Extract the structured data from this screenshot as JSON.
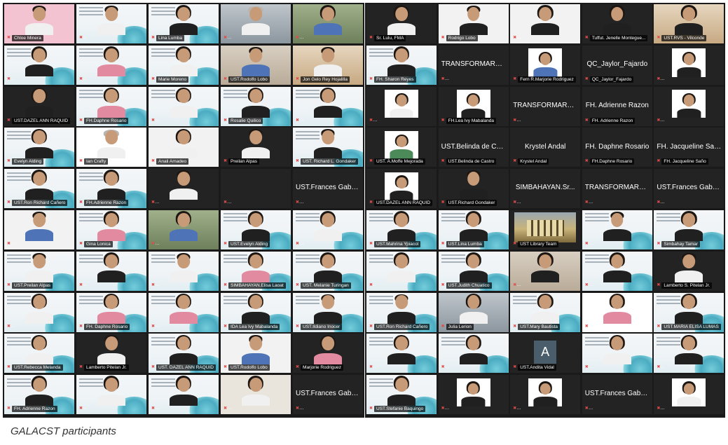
{
  "caption": "GALACST participants",
  "left_panel": [
    {
      "name": "Chloe Minera",
      "bg": "pink",
      "kind": "person",
      "hair": "short",
      "shirt": "white"
    },
    {
      "name": "UST.ALANNOYHUGO C.REYES",
      "bg": "slide",
      "kind": "person",
      "hair": "short",
      "shirt": "white"
    },
    {
      "name": "Lina Lumba",
      "bg": "slide",
      "kind": "person",
      "shirt": "black"
    },
    {
      "name": "SMH. Sr. Rosy Rampaje, O.P.",
      "bg": "room2",
      "kind": "person",
      "hair": "gray",
      "shirt": "white"
    },
    {
      "name": "Simbahayan. Sr. Maurice Bu...",
      "bg": "green",
      "kind": "person",
      "shirt": "blue"
    },
    {
      "name": "UST.KATRINA MARIA MITSRANAN",
      "bg": "slide",
      "kind": "person",
      "shirt": "black"
    },
    {
      "name": "IDA. Marie Vinna Gamusan",
      "bg": "slide",
      "kind": "person",
      "shirt": "pink"
    },
    {
      "name": "Marie Moreno",
      "bg": "slide",
      "kind": "person",
      "shirt": "white"
    },
    {
      "name": "UST.Rodolfo Lobo",
      "bg": "room",
      "kind": "person",
      "hair": "short",
      "shirt": "blue"
    },
    {
      "name": "Jon Gelo Rey Hojalilla",
      "bg": "warm",
      "kind": "person",
      "hair": "short",
      "shirt": "white"
    },
    {
      "name": "UST.DAZEL ANN RAQUID",
      "bg": "dark",
      "kind": "person",
      "shirt": "black"
    },
    {
      "name": "FH.Daphne Rosario",
      "bg": "slide",
      "kind": "person",
      "shirt": "pink"
    },
    {
      "name": "UST.CAMILLA J. VECCHIOS",
      "bg": "slide",
      "kind": "person",
      "shirt": "white"
    },
    {
      "name": "Rosalie Quilico",
      "bg": "slide",
      "kind": "person",
      "shirt": "black"
    },
    {
      "name": "UST.ROSALYN D.MIRANDO",
      "bg": "slide",
      "kind": "person",
      "shirt": "black"
    },
    {
      "name": "Evelyn Alding",
      "bg": "slide",
      "kind": "person",
      "shirt": "black"
    },
    {
      "name": "Ian Crafty",
      "bg": "white",
      "kind": "person",
      "hair": "gray",
      "shirt": "white"
    },
    {
      "name": "Anali Amadeo",
      "bg": "plain",
      "kind": "person",
      "shirt": "white"
    },
    {
      "name": "Preilan Alpas",
      "bg": "dark",
      "kind": "person",
      "hair": "short",
      "shirt": "white"
    },
    {
      "name": "UST. Richard L. Gondaker",
      "bg": "slide",
      "kind": "person",
      "hair": "short",
      "shirt": "black"
    },
    {
      "name": "UST.Ron Richard Cañero",
      "bg": "slide",
      "kind": "person",
      "shirt": "black"
    },
    {
      "name": "FH.Adrienne Razon",
      "bg": "slide",
      "kind": "person",
      "shirt": "black"
    },
    {
      "name": "CAMPHS-Lamberto Pitelan Jr.",
      "bg": "dark",
      "kind": "person",
      "hair": "short",
      "shirt": "white"
    },
    {
      "name": "TRANSFORMARE.JESSICA FE...",
      "bg": "dark",
      "kind": "empty"
    },
    {
      "name": "UST.Frances Gabrielle Cruz 1",
      "bg": "dark",
      "kind": "text",
      "label": "UST.Frances Gabri...",
      "active": true
    },
    {
      "name": "SIMBAHAYAN.Madeleine Te...",
      "bg": "plain",
      "kind": "person",
      "hair": "short",
      "shirt": "blue"
    },
    {
      "name": "Gina Lonica",
      "bg": "slide",
      "kind": "person",
      "shirt": "pink"
    },
    {
      "name": "Simbahayan. Sr. Maurice Bu...",
      "bg": "green",
      "kind": "person",
      "shirt": "blue"
    },
    {
      "name": "UST.Evelyn Alding",
      "bg": "slide",
      "kind": "person",
      "shirt": "black"
    },
    {
      "name": "SIMBAHAYAN.Sr.Shirley G. All...",
      "bg": "slide",
      "kind": "person",
      "shirt": "white"
    },
    {
      "name": "UST.Preilan Alpas",
      "bg": "slide",
      "kind": "person",
      "hair": "short",
      "shirt": "white"
    },
    {
      "name": "UST.KATRINA MARIA M.TERA...",
      "bg": "slide",
      "kind": "person",
      "shirt": "black"
    },
    {
      "name": "UST.ALANNOYHUGO C.REYES",
      "bg": "slide",
      "kind": "person",
      "hair": "short",
      "shirt": "white"
    },
    {
      "name": "SIMBAHAYAN.Elisa Laoat",
      "bg": "slide",
      "kind": "person",
      "shirt": "pink"
    },
    {
      "name": "UST. Melanie Turingan",
      "bg": "slide",
      "kind": "person",
      "shirt": "black"
    },
    {
      "name": "SIMBAHAYAN. Marie Moreno",
      "bg": "slide",
      "kind": "person",
      "shirt": "white"
    },
    {
      "name": "FH. Daphne Rosario",
      "bg": "slide",
      "kind": "person",
      "shirt": "pink"
    },
    {
      "name": "IDA. Marie Vinna Gamusan",
      "bg": "slide",
      "kind": "person",
      "shirt": "pink"
    },
    {
      "name": "IDA Lea Ivy Mabalanda",
      "bg": "slide",
      "kind": "person",
      "shirt": "black"
    },
    {
      "name": "UST.Ildiano Inocer",
      "bg": "slide",
      "kind": "person",
      "hair": "short",
      "shirt": "black"
    },
    {
      "name": "UST.Rebecca Melanda",
      "bg": "slide",
      "kind": "person",
      "shirt": "white"
    },
    {
      "name": "Lamberto Pitelan Jr.",
      "bg": "dark",
      "kind": "person",
      "hair": "short",
      "shirt": "white"
    },
    {
      "name": "UST. DAZEL ANN RAQUID",
      "bg": "slide",
      "kind": "person",
      "shirt": "black"
    },
    {
      "name": "UST.Rodolfo Lobo",
      "bg": "plain",
      "kind": "person",
      "hair": "short",
      "shirt": "blue"
    },
    {
      "name": "Marjorie Rodriguez",
      "bg": "dark",
      "kind": "person",
      "shirt": "pink"
    },
    {
      "name": "FH. Adrienne Razon",
      "bg": "slide",
      "kind": "person",
      "shirt": "black"
    },
    {
      "name": "UST.CAMILLA J.VECCHIOS",
      "bg": "slide",
      "kind": "person",
      "shirt": "white"
    },
    {
      "name": "TRANSFORMARE. Rosalie Qui...",
      "bg": "slide",
      "kind": "person",
      "shirt": "black"
    },
    {
      "name": "Simbahayan Sr.Ruby Clare Jo...",
      "bg": "pale",
      "kind": "person",
      "shirt": "white"
    },
    {
      "name": "UST.Frances Gabrielle Cruz 1",
      "bg": "dark",
      "kind": "text",
      "label": "UST.Frances Gabri..."
    }
  ],
  "right_panel": [
    {
      "name": "Sr. Lulu, FMA",
      "bg": "dark",
      "kind": "person",
      "shirt": "white"
    },
    {
      "name": "Rodrigo Lobo",
      "bg": "plain",
      "kind": "person",
      "hair": "short",
      "shirt": "black"
    },
    {
      "name": "UST. MARIA ELISA LUMAS",
      "bg": "plain",
      "kind": "person",
      "shirt": "black"
    },
    {
      "name": "Tuffut. Jenelle Montegue...",
      "bg": "dark",
      "kind": "person",
      "shirt": "black"
    },
    {
      "name": "UST.RVS - Vilconde",
      "bg": "warm",
      "kind": "person",
      "shirt": "black"
    },
    {
      "name": "FH. Sharon Reyes",
      "bg": "slide",
      "kind": "person",
      "shirt": "black"
    },
    {
      "name": "TRANSFORMARE.Amancio P...",
      "bg": "dark",
      "kind": "text",
      "label": "TRANSFORMARE..."
    },
    {
      "name": "Fern R.Marjorie Rodriguez",
      "bg": "dark",
      "kind": "card",
      "shirt": "blue"
    },
    {
      "name": "QC_Jaylor_Fajardo",
      "bg": "dark",
      "kind": "text",
      "label": "QC_Jaylor_Fajardo"
    },
    {
      "name": "UST. A.LYNNA DOMINGEZ",
      "bg": "dark",
      "kind": "card",
      "shirt": "black"
    },
    {
      "name": "UST.Frances Gabrielle Cruz 2",
      "bg": "dark",
      "kind": "card",
      "shirt": "white"
    },
    {
      "name": "FH.Lea Ivy Mabalanda",
      "bg": "dark",
      "kind": "card",
      "shirt": "black"
    },
    {
      "name": "TRANSFORMARE.JESSICA FE...",
      "bg": "dark",
      "kind": "text",
      "label": "TRANSFORMARE..."
    },
    {
      "name": "FH. Adrienne Razon",
      "bg": "dark",
      "kind": "text",
      "label": "FH. Adrienne Razon"
    },
    {
      "name": "UST.ROSALYN D.MIRANDO",
      "bg": "dark",
      "kind": "card",
      "shirt": "black"
    },
    {
      "name": "UST. A.Moffe Mejorada",
      "bg": "dark",
      "kind": "card",
      "shirt": "green"
    },
    {
      "name": "UST.Belinda de Castro",
      "bg": "dark",
      "kind": "text",
      "label": "UST.Belinda de Ca..."
    },
    {
      "name": "Krystel Andal",
      "bg": "dark",
      "kind": "text",
      "label": "Krystel Andal"
    },
    {
      "name": "FH.Daphne Rosario",
      "bg": "dark",
      "kind": "text",
      "label": "FH. Daphne Rosario"
    },
    {
      "name": "FH. Jacqueline Saño",
      "bg": "dark",
      "kind": "text",
      "label": "FH. Jacqueline Saño"
    },
    {
      "name": "UST.DAZEL ANN RAQUID",
      "bg": "dark",
      "kind": "card",
      "shirt": "black"
    },
    {
      "name": "UST.Richard Gondaker",
      "bg": "dark",
      "kind": "person",
      "hair": "short",
      "shirt": "black"
    },
    {
      "name": "SIMBAHAYAN.Sr. Madeleine T...",
      "bg": "dark",
      "kind": "text",
      "label": "SIMBAHAYAN.Sr..."
    },
    {
      "name": "TRANSFORMARE.Rosemarie...",
      "bg": "dark",
      "kind": "text",
      "label": "TRANSFORMARE..."
    },
    {
      "name": "UST.Frances Gabrielle Cruz 2",
      "bg": "dark",
      "kind": "text",
      "label": "UST.Frances Gabri..."
    },
    {
      "name": "UST.Mahrina Ypiacol",
      "bg": "slide",
      "kind": "person",
      "shirt": "black"
    },
    {
      "name": "UST.Lina Lumba",
      "bg": "slide",
      "kind": "person",
      "shirt": "black"
    },
    {
      "name": "UST Library Team",
      "bg": "dark",
      "kind": "building",
      "active": true
    },
    {
      "name": "UST.RICHARD L. GONDAKER",
      "bg": "slide",
      "kind": "person",
      "hair": "short",
      "shirt": "black"
    },
    {
      "name": "Simbahay Tamar",
      "bg": "slide",
      "kind": "person",
      "shirt": "black"
    },
    {
      "name": "TRANSFORMARE. Grace Reco",
      "bg": "slide",
      "kind": "person",
      "shirt": "white"
    },
    {
      "name": "UST.Judith Chuatico",
      "bg": "slide",
      "kind": "person",
      "shirt": "black"
    },
    {
      "name": "TRANSFORMARE.Joshua Gra...",
      "bg": "room",
      "kind": "person",
      "shirt": "black"
    },
    {
      "name": "UST.ROSALYN D.MIRANDO",
      "bg": "slide",
      "kind": "person",
      "shirt": "black"
    },
    {
      "name": "Lamberto S. Pitelan Jr.",
      "bg": "dark",
      "kind": "person",
      "hair": "short",
      "shirt": "white"
    },
    {
      "name": "UST.Ron Richard Cañero",
      "bg": "slide",
      "kind": "person",
      "hair": "short",
      "shirt": "black"
    },
    {
      "name": "Julia Lerion",
      "bg": "room2",
      "kind": "person",
      "shirt": "white"
    },
    {
      "name": "UST.Mary Bautista",
      "bg": "slide",
      "kind": "person",
      "shirt": "white"
    },
    {
      "name": "Farid R. Marjorie Rodriguez",
      "bg": "white",
      "kind": "person",
      "shirt": "pink"
    },
    {
      "name": "UST.MARIA ELISA LUMAS",
      "bg": "slide",
      "kind": "person",
      "shirt": "black"
    },
    {
      "name": "UST.DAZEL ANN VARQUEZ",
      "bg": "slide",
      "kind": "person",
      "shirt": "black"
    },
    {
      "name": "TRANSFORMARE. Rosalie Qui...",
      "bg": "slide",
      "kind": "person",
      "shirt": "black"
    },
    {
      "name": "UST.Andita Vidal",
      "bg": "dark",
      "kind": "avatar",
      "initial": "A"
    },
    {
      "name": "UST.CAMILLA J.VECCHIOS",
      "bg": "slide",
      "kind": "person",
      "shirt": "white"
    },
    {
      "name": "UNIVERSE Ethel Ashley de Vo...",
      "bg": "slide",
      "kind": "person",
      "shirt": "black"
    },
    {
      "name": "UST.Stefanie Baquingo",
      "bg": "slide",
      "kind": "person",
      "shirt": "black"
    },
    {
      "name": "IDA. Marie Vinna Ditty Gume...",
      "bg": "dark",
      "kind": "card",
      "shirt": "black"
    },
    {
      "name": "UST. A.LYNNA DOMINGEZ",
      "bg": "dark",
      "kind": "card",
      "shirt": "black"
    },
    {
      "name": "UST.Frances Gabrielle Cruz 1",
      "bg": "dark",
      "kind": "text",
      "label": "UST.Frances Gabri..."
    },
    {
      "name": "UST.Frances Gabrielle Cruz 2",
      "bg": "dark",
      "kind": "card",
      "shirt": "white"
    }
  ]
}
